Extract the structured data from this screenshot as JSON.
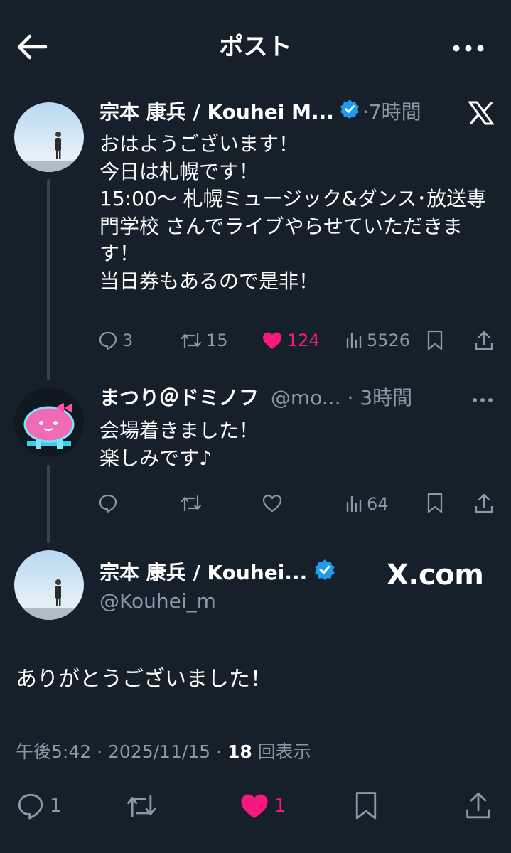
{
  "header": {
    "title": "ポスト",
    "back_icon": "arrow-left-icon",
    "more_icon": "more-horizontal-icon"
  },
  "tweet1": {
    "name": "宗本 康兵 / Kouhei M...",
    "verified": true,
    "time": "7時間",
    "text": "おはようございます！\n今日は札幌です！\n15:00〜 札幌ミュージック&ダンス･放送専門学校 さんでライブやらせていただきます！\n当日券もあるので是非！",
    "replies": "3",
    "retweets": "15",
    "likes": "124",
    "views": "5526"
  },
  "tweet2": {
    "name": "まつり＠ドミノフ",
    "handle": "@mo...",
    "time": "3時間",
    "text": "会場着きました！\n楽しみです♪",
    "views": "64"
  },
  "main_tweet": {
    "name": "宗本 康兵 / Kouhei...",
    "handle": "@Kouhei_m",
    "watermark": "X.com",
    "text": "ありがとうございました！",
    "time": "午後5:42",
    "date": "2025/11/15",
    "view_count": "18",
    "view_label": "回表示",
    "replies": "1",
    "likes": "1"
  },
  "colors": {
    "background": "#15202b",
    "muted": "#8b98a5",
    "like": "#f91880",
    "verified": "#1d9bf0",
    "thread_line": "#38444d"
  }
}
